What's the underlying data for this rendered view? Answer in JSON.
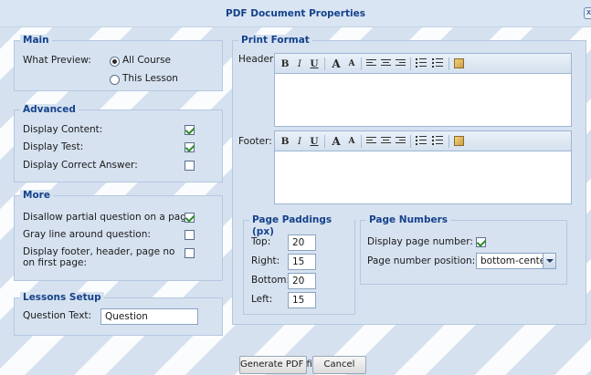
{
  "dialog": {
    "title": "PDF Document Properties"
  },
  "main": {
    "legend": "Main",
    "what_preview_label": "What Preview:",
    "options": [
      {
        "label": "All Course",
        "selected": true
      },
      {
        "label": "This Lesson",
        "selected": false
      }
    ]
  },
  "advanced": {
    "legend": "Advanced",
    "items": [
      {
        "label": "Display Content:",
        "checked": true
      },
      {
        "label": "Display Test:",
        "checked": true
      },
      {
        "label": "Display Correct Answer:",
        "checked": false
      }
    ]
  },
  "more": {
    "legend": "More",
    "items": [
      {
        "label": "Disallow partial question on a page:",
        "checked": true
      },
      {
        "label": "Gray line around question:",
        "checked": false
      },
      {
        "label": "Display footer, header, page no on first page:",
        "checked": false
      }
    ]
  },
  "lessons_setup": {
    "legend": "Lessons Setup",
    "question_text_label": "Question Text:",
    "question_text_value": "Question"
  },
  "print_format": {
    "legend": "Print Format",
    "header_label": "Header:",
    "footer_label": "Footer:",
    "toolbar": {
      "bold": "B",
      "italic": "I",
      "underline": "U",
      "grow": "A",
      "shrink": "A"
    }
  },
  "page_paddings": {
    "legend": "Page Paddings (px)",
    "fields": [
      {
        "label": "Top:",
        "value": "20"
      },
      {
        "label": "Right:",
        "value": "15"
      },
      {
        "label": "Bottom:",
        "value": "20"
      },
      {
        "label": "Left:",
        "value": "15"
      }
    ]
  },
  "page_numbers": {
    "legend": "Page Numbers",
    "display_label": "Display page number:",
    "display_checked": true,
    "position_label": "Page number position:",
    "position_value": "bottom-center"
  },
  "buttons": {
    "generate": "Generate PDF file",
    "cancel": "Cancel"
  }
}
